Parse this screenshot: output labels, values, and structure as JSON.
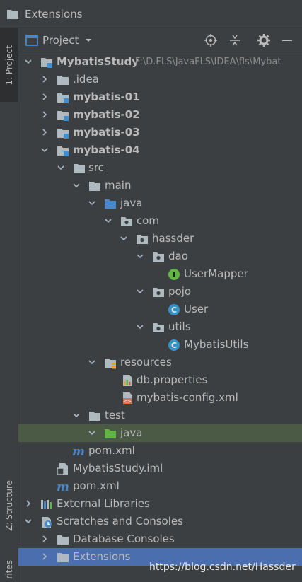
{
  "window": {
    "title": "Extensions"
  },
  "sidebar": {
    "tab_project": "1: Project",
    "tab_structure": "Z: Structure",
    "tab_favorites": "rites"
  },
  "panel": {
    "title": "Project"
  },
  "tree": {
    "root": {
      "label": "MybatisStudy",
      "path": "F:\\D.FLS\\JavaFLS\\IDEA\\fls\\Mybat"
    },
    "idea": ".idea",
    "m01": "mybatis-01",
    "m02": "mybatis-02",
    "m03": "mybatis-03",
    "m04": "mybatis-04",
    "src": "src",
    "main": "main",
    "java": "java",
    "com": "com",
    "hassder": "hassder",
    "dao": "dao",
    "usermapper": "UserMapper",
    "pojo": "pojo",
    "user": "User",
    "utils": "utils",
    "mybatisutils": "MybatisUtils",
    "resources": "resources",
    "dbprops": "db.properties",
    "mbconfig": "mybatis-config.xml",
    "test": "test",
    "testjava": "java",
    "pom04": "pom.xml",
    "iml": "MybatisStudy.iml",
    "pomroot": "pom.xml",
    "extlibs": "External Libraries",
    "scratches": "Scratches and Consoles",
    "dbconsoles": "Database Consoles",
    "extensions": "Extensions"
  },
  "watermark": "https://blog.csdn.net/Hassder",
  "colors": {
    "accent_selection": "#4b6eaf",
    "source_folder_blue": "#4a88c7",
    "test_folder_green": "#62b543",
    "class_icon": "#3592c4",
    "interface_icon": "#62b543"
  }
}
